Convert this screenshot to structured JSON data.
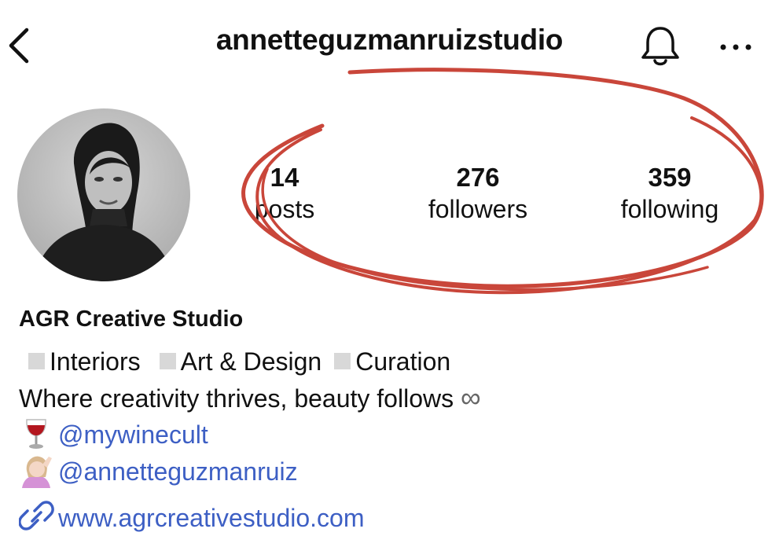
{
  "header": {
    "back_icon": "chevron-left-icon",
    "username": "annetteguzmanruizstudio",
    "bell_icon": "bell-icon",
    "more_icon": "more-horizontal-icon"
  },
  "profile": {
    "avatar_alt": "profile-photo",
    "stats": [
      {
        "value": "14",
        "label": "posts"
      },
      {
        "value": "276",
        "label": "followers"
      },
      {
        "value": "359",
        "label": "following"
      }
    ]
  },
  "bio": {
    "name": "AGR Creative Studio",
    "categories": [
      "Interiors",
      "Art & Design",
      "Curation"
    ],
    "tagline": "Where creativity thrives, beauty follows",
    "tagline_symbol": "∞",
    "links": [
      {
        "icon": "wine-glass-icon",
        "text": "@mywinecult"
      },
      {
        "icon": "person-tipping-hand-icon",
        "text": "@annetteguzmanruiz"
      }
    ],
    "website": {
      "icon": "link-icon",
      "text": "www.agrcreativestudio.com"
    }
  },
  "annotation": {
    "stroke_color": "#c9463a"
  }
}
